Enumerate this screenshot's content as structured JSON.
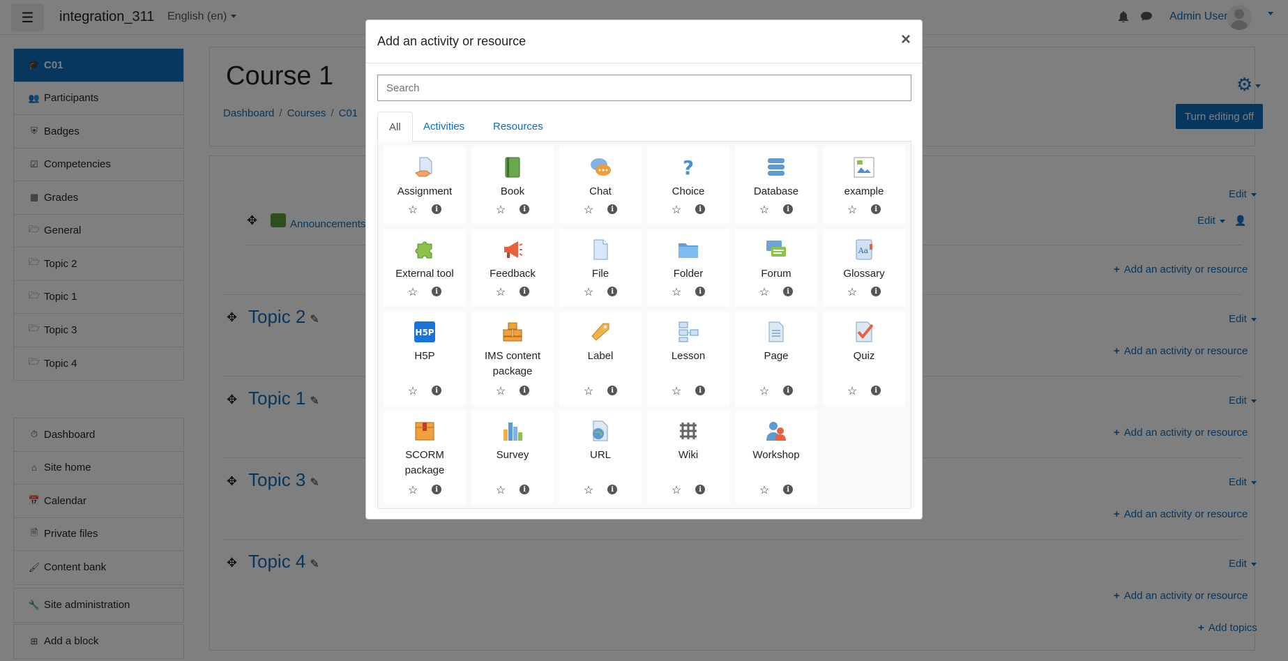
{
  "navbar": {
    "site_name": "integration_311",
    "language": "English (en)",
    "user_name": "Admin User",
    "menu_icon": "hamburger-icon",
    "notification_icon": "bell-icon",
    "messages_icon": "chat-bubble-icon"
  },
  "drawer": {
    "course_items": [
      {
        "label": "C01",
        "icon": "graduation-cap-icon"
      },
      {
        "label": "Participants",
        "icon": "users-icon"
      },
      {
        "label": "Badges",
        "icon": "shield-icon"
      },
      {
        "label": "Competencies",
        "icon": "check-square-icon"
      },
      {
        "label": "Grades",
        "icon": "table-icon"
      },
      {
        "label": "General",
        "icon": "folder-icon"
      },
      {
        "label": "Topic 2",
        "icon": "folder-icon"
      },
      {
        "label": "Topic 1",
        "icon": "folder-icon"
      },
      {
        "label": "Topic 3",
        "icon": "folder-icon"
      },
      {
        "label": "Topic 4",
        "icon": "folder-icon"
      }
    ],
    "site_items": [
      {
        "label": "Dashboard",
        "icon": "tachometer-icon"
      },
      {
        "label": "Site home",
        "icon": "home-icon"
      },
      {
        "label": "Calendar",
        "icon": "calendar-icon"
      },
      {
        "label": "Private files",
        "icon": "file-icon"
      },
      {
        "label": "Content bank",
        "icon": "paintbrush-icon"
      }
    ],
    "admin_items": [
      {
        "label": "Site administration",
        "icon": "wrench-icon"
      }
    ],
    "block_items": [
      {
        "label": "Add a block",
        "icon": "plus-square-icon"
      }
    ]
  },
  "page": {
    "course_title": "Course 1",
    "breadcrumb": [
      "Dashboard",
      "Courses",
      "C01"
    ],
    "turn_editing_off": "Turn editing off",
    "edit_label": "Edit",
    "add_activity_label": "Add an activity or resource",
    "add_topics_label": "Add topics",
    "announcements": "Announcements",
    "topics": [
      "Topic 2",
      "Topic 1",
      "Topic 3",
      "Topic 4"
    ]
  },
  "modal": {
    "title": "Add an activity or resource",
    "close": "×",
    "search_placeholder": "Search",
    "tabs": [
      "All",
      "Activities",
      "Resources"
    ],
    "active_tab": "All",
    "modules": [
      {
        "name": "Assignment",
        "icon": "assignment-icon"
      },
      {
        "name": "Book",
        "icon": "book-icon"
      },
      {
        "name": "Chat",
        "icon": "chat-icon"
      },
      {
        "name": "Choice",
        "icon": "choice-icon"
      },
      {
        "name": "Database",
        "icon": "database-icon"
      },
      {
        "name": "example",
        "icon": "broken-image-icon"
      },
      {
        "name": "External tool",
        "icon": "puzzle-icon"
      },
      {
        "name": "Feedback",
        "icon": "megaphone-icon"
      },
      {
        "name": "File",
        "icon": "file-icon"
      },
      {
        "name": "Folder",
        "icon": "folder-icon"
      },
      {
        "name": "Forum",
        "icon": "forum-icon"
      },
      {
        "name": "Glossary",
        "icon": "glossary-icon"
      },
      {
        "name": "H5P",
        "icon": "h5p-icon"
      },
      {
        "name": "IMS content package",
        "icon": "ims-package-icon"
      },
      {
        "name": "Label",
        "icon": "label-icon"
      },
      {
        "name": "Lesson",
        "icon": "lesson-icon"
      },
      {
        "name": "Page",
        "icon": "page-icon"
      },
      {
        "name": "Quiz",
        "icon": "quiz-icon"
      },
      {
        "name": "SCORM package",
        "icon": "scorm-icon"
      },
      {
        "name": "Survey",
        "icon": "survey-icon"
      },
      {
        "name": "URL",
        "icon": "url-icon"
      },
      {
        "name": "Wiki",
        "icon": "wiki-icon"
      },
      {
        "name": "Workshop",
        "icon": "workshop-icon"
      }
    ]
  },
  "colors": {
    "primary": "#0f6cbf",
    "overlay": "rgba(0,0,0,0.5)"
  }
}
